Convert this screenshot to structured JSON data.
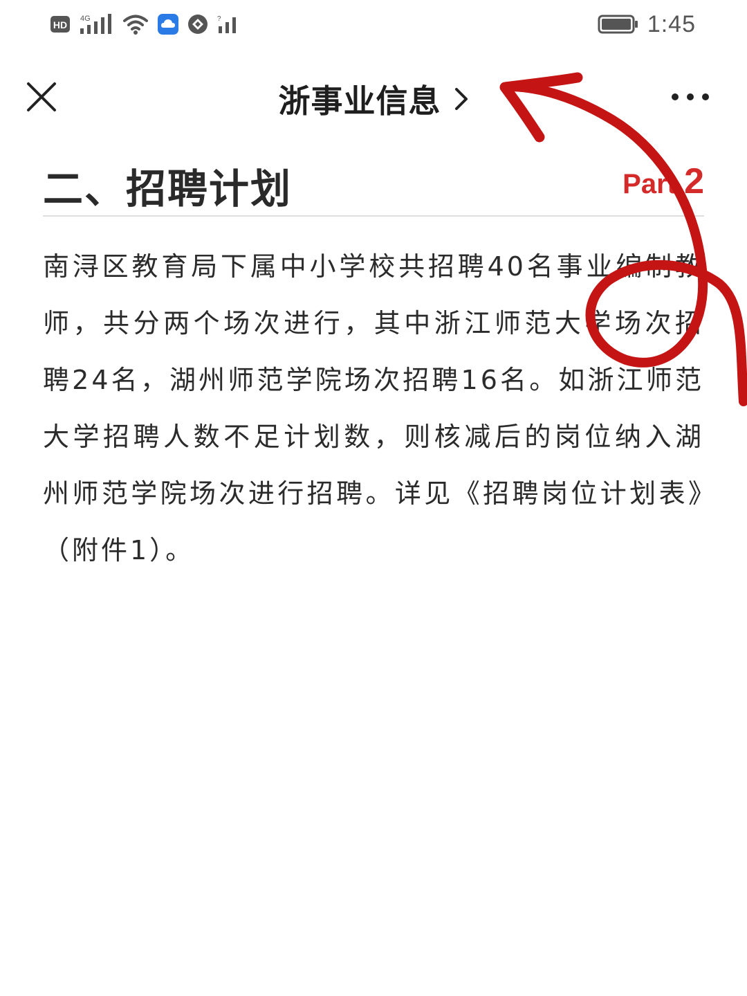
{
  "status_bar": {
    "time": "1:45",
    "left_icons": [
      "hd-icon",
      "signal-4g-icon",
      "wifi-icon",
      "cloud-app-icon",
      "vpn-app-icon",
      "signal-icon"
    ],
    "battery_icon": "battery-icon"
  },
  "nav": {
    "title": "浙事业信息",
    "close_icon": "close-icon",
    "chevron_icon": "chevron-right-icon",
    "more_icon": "more-icon"
  },
  "section": {
    "title": "二、招聘计划",
    "part_prefix": "Part ",
    "part_number": "2"
  },
  "body": {
    "paragraph": "南浔区教育局下属中小学校共招聘40名事业编制教师，共分两个场次进行，其中浙江师范大学场次招聘24名，湖州师范学院场次招聘16名。如浙江师范大学招聘人数不足计划数，则核减后的岗位纳入湖州师范学院场次进行招聘。详见《招聘岗位计划表》（附件1）。"
  },
  "annotation": {
    "arrow_color": "#c41414",
    "icon": "hand-drawn-arrow-icon"
  }
}
